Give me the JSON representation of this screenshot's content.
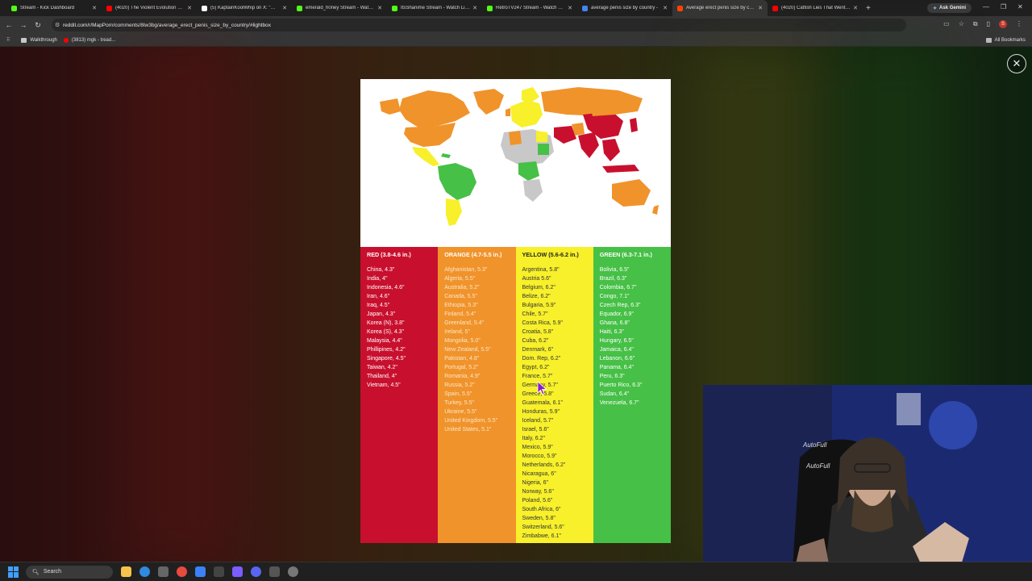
{
  "browser": {
    "tabs": [
      {
        "title": "Stream - Kick Dashboard",
        "color": "#53fc18"
      },
      {
        "title": "(4020) The Violent Evolution of ...",
        "color": "#ff0000"
      },
      {
        "title": "(5) KaptainKoolWhip on X: \"Wh...",
        "color": "#ffffff"
      },
      {
        "title": "emerald_h0ney Stream - Watch ...",
        "color": "#53fc18"
      },
      {
        "title": "ItsShanime Stream - Watch Liv...",
        "color": "#53fc18"
      },
      {
        "title": "RetroTV247 Stream - Watch Liv...",
        "color": "#53fc18"
      },
      {
        "title": "average penis size by country -",
        "color": "#4285f4"
      },
      {
        "title": "Average erect penis size by cou...",
        "color": "#ff4500",
        "active": true
      },
      {
        "title": "(4020) Catfish Lies That Went F...",
        "color": "#ff0000"
      }
    ],
    "new_tab": "+",
    "ask_gemini": "Ask Gemini",
    "url": "reddit.com/r/MapPorn/comments/8tw3bg/average_erect_penis_size_by_country/#lightbox",
    "bookmarks": [
      {
        "label": "Walkthrough"
      },
      {
        "label": "(3813) mgk - tread..."
      }
    ],
    "all_bookmarks": "All Bookmarks",
    "profile_initial": "S"
  },
  "lightbox": {
    "close_symbol": "✕",
    "legend": {
      "red": {
        "header": "RED (3.8-4.6 in.)",
        "items": [
          "China, 4.3\"",
          "India, 4\"",
          "Indonesia, 4.6\"",
          "Iran, 4.6\"",
          "Iraq, 4.5\"",
          "Japan, 4.3\"",
          "Korea (N), 3.8\"",
          "Korea (S), 4.3\"",
          "Malaysia, 4.4\"",
          "Phillipines, 4.2\"",
          "Singapore, 4.5\"",
          "Taiwan, 4.2\"",
          "Thailand, 4\"",
          "Vietnam, 4.5\""
        ]
      },
      "orange": {
        "header": "ORANGE (4.7-5.5 in.)",
        "items": [
          "Afghanistan, 5.3\"",
          "Algeria, 5.5\"",
          "Australia, 5.2\"",
          "Canada, 5.5\"",
          "Ethiopia, 5.3\"",
          "Finland, 5.4\"",
          "Greenland, 5.4\"",
          "Ireland, 5\"",
          "Mongolia, 5.0\"",
          "New Zealand, 5.5\"",
          "Pakistan, 4.8\"",
          "Portugal, 5.2\"",
          "Romania, 4.9\"",
          "Russia, 5.2\"",
          "Spain, 5.5\"",
          "Turkey, 5.5\"",
          "Ukraine, 5.5\"",
          "United Kingdom, 5.5\"",
          "United States, 5.1\""
        ]
      },
      "yellow": {
        "header": "YELLOW (5.6-6.2 in.)",
        "items": [
          "Argentina, 5.8\"",
          "Austria 5.6\"",
          "Belgium, 6.2\"",
          "Belize, 6.2\"",
          "Bulgaria, 5.9\"",
          "Chile, 5.7\"",
          "Costa Rica, 5.9\"",
          "Croatia, 5.8\"",
          "Cuba, 6.2\"",
          "Denmark, 6\"",
          "Dom. Rep, 6.2\"",
          "Egypt, 6.2\"",
          "France, 5.7\"",
          "Germany, 5.7\"",
          "Greece, 5.8\"",
          "Guatemala, 6.1\"",
          "Honduras, 5.9\"",
          "Iceland, 5.7\"",
          "Israel, 5.6\"",
          "Italy, 6.2\"",
          "Mexico, 5.9\"",
          "Morocco, 5.9\"",
          "Netherlands, 6.2\"",
          "Nicaragua, 6\"",
          "Nigeria, 6\"",
          "Norway, 5.6\"",
          "Poland, 5.6\"",
          "South Africa, 6\"",
          "Sweden, 5.8\"",
          "Switzerland, 5.6\"",
          "Zimbabwe, 6.1\""
        ]
      },
      "green": {
        "header": "GREEN (6.3-7.1 in.)",
        "items": [
          "Bolivia, 6.5\"",
          "Brazil, 6.3\"",
          "Colombia, 6.7\"",
          "Congo, 7.1\"",
          "Czech Rep, 6.3\"",
          "Equador, 6.9\"",
          "Ghana, 6.8\"",
          "Haiti, 6.3\"",
          "Hungary, 6.5\"",
          "Jamaica, 6.4\"",
          "Lebanon, 6.6\"",
          "Panama, 6.4\"",
          "Peru, 6.3\"",
          "Puerto Rico, 6.3\"",
          "Sudan, 6.4\"",
          "Venezuela, 6.7\""
        ]
      }
    },
    "colors": {
      "red": "#c8102e",
      "orange": "#f0932b",
      "yellow": "#f7f02a",
      "green": "#46c046",
      "nodata": "#c8c8c8"
    }
  },
  "webcam": {
    "chair_brand_text": [
      "AutoFull",
      "AutoFull"
    ]
  },
  "taskbar": {
    "search_label": "Search",
    "apps": [
      "file-explorer-icon",
      "edge-icon",
      "store-icon",
      "chrome-icon",
      "app-icon",
      "app-icon",
      "app-icon",
      "discord-icon",
      "app-icon",
      "settings-icon"
    ]
  }
}
